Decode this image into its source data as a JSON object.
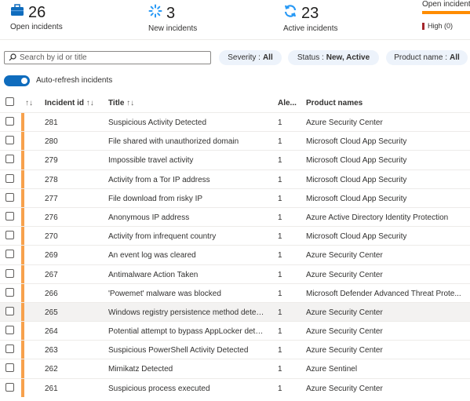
{
  "stats": {
    "open": {
      "value": "26",
      "label": "Open incidents",
      "icon": "briefcase-icon"
    },
    "new": {
      "value": "3",
      "label": "New incidents",
      "icon": "spinner-icon"
    },
    "active": {
      "value": "23",
      "label": "Active incidents",
      "icon": "refresh-icon"
    }
  },
  "severity_card": {
    "title": "Open incidents",
    "high_label": "High (0)"
  },
  "search": {
    "placeholder": "Search by id or title"
  },
  "filters": [
    {
      "name": "Severity",
      "value": "All"
    },
    {
      "name": "Status",
      "value": "New, Active"
    },
    {
      "name": "Product name",
      "value": "All"
    }
  ],
  "auto_refresh": {
    "label": "Auto-refresh incidents",
    "on": true
  },
  "table": {
    "headers": {
      "id": "Incident id",
      "title": "Title",
      "alerts": "Ale...",
      "product": "Product names"
    },
    "rows": [
      {
        "id": "281",
        "title": "Suspicious Activity Detected",
        "alerts": "1",
        "product": "Azure Security Center"
      },
      {
        "id": "280",
        "title": "File shared with unauthorized domain",
        "alerts": "1",
        "product": "Microsoft Cloud App Security"
      },
      {
        "id": "279",
        "title": "Impossible travel activity",
        "alerts": "1",
        "product": "Microsoft Cloud App Security"
      },
      {
        "id": "278",
        "title": "Activity from a Tor IP address",
        "alerts": "1",
        "product": "Microsoft Cloud App Security"
      },
      {
        "id": "277",
        "title": "File download from risky IP",
        "alerts": "1",
        "product": "Microsoft Cloud App Security"
      },
      {
        "id": "276",
        "title": "Anonymous IP address",
        "alerts": "1",
        "product": "Azure Active Directory Identity Protection"
      },
      {
        "id": "270",
        "title": "Activity from infrequent country",
        "alerts": "1",
        "product": "Microsoft Cloud App Security"
      },
      {
        "id": "269",
        "title": "An event log was cleared",
        "alerts": "1",
        "product": "Azure Security Center"
      },
      {
        "id": "267",
        "title": "Antimalware Action Taken",
        "alerts": "1",
        "product": "Azure Security Center"
      },
      {
        "id": "266",
        "title": "'Powemet' malware was blocked",
        "alerts": "1",
        "product": "Microsoft Defender Advanced Threat Prote..."
      },
      {
        "id": "265",
        "title": "Windows registry persistence method detec...",
        "alerts": "1",
        "product": "Azure Security Center"
      },
      {
        "id": "264",
        "title": "Potential attempt to bypass AppLocker dete...",
        "alerts": "1",
        "product": "Azure Security Center"
      },
      {
        "id": "263",
        "title": "Suspicious PowerShell Activity Detected",
        "alerts": "1",
        "product": "Azure Security Center"
      },
      {
        "id": "262",
        "title": "Mimikatz Detected",
        "alerts": "1",
        "product": "Azure Sentinel"
      },
      {
        "id": "261",
        "title": "Suspicious process executed",
        "alerts": "1",
        "product": "Azure Security Center"
      }
    ],
    "highlighted_row": "265"
  },
  "colors": {
    "accent": "#0f6cbd",
    "severity_stripe": "#f7a14c",
    "high": "#a4262c",
    "bar": "#ff8c00"
  }
}
